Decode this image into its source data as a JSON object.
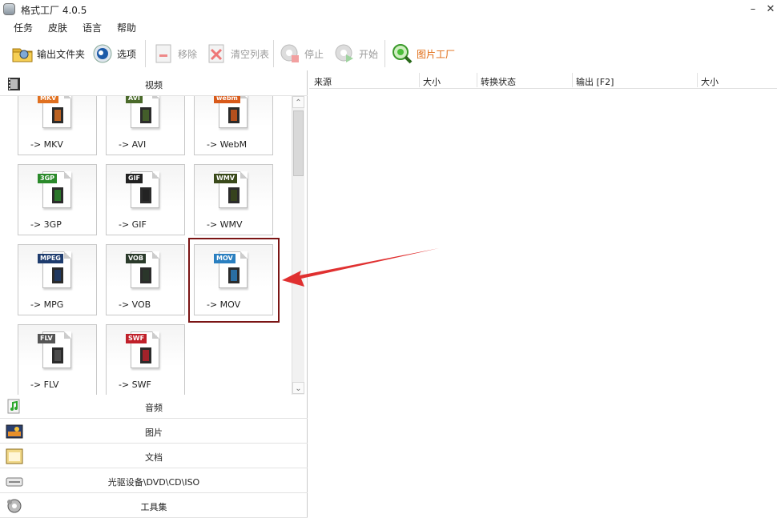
{
  "app": {
    "title": "格式工厂 4.0.5"
  },
  "menu": [
    "任务",
    "皮肤",
    "语言",
    "帮助"
  ],
  "toolbar": {
    "output_folder": "输出文件夹",
    "options": "选项",
    "remove": "移除",
    "clear_list": "清空列表",
    "stop": "停止",
    "start": "开始",
    "picture_factory": "图片工厂"
  },
  "categories": {
    "video": "视频",
    "audio": "音频",
    "image": "图片",
    "document": "文档",
    "optical": "光驱设备\\DVD\\CD\\ISO",
    "tools": "工具集"
  },
  "tiles": [
    {
      "badge": "MKV",
      "label": "-> MKV",
      "color": "#e07020"
    },
    {
      "badge": "AVI",
      "label": "-> AVI",
      "color": "#4a6a2a"
    },
    {
      "badge": "webm",
      "label": "-> WebM",
      "color": "#d85a1a"
    },
    {
      "badge": "3GP",
      "label": "-> 3GP",
      "color": "#2b8a2b"
    },
    {
      "badge": "GIF",
      "label": "-> GIF",
      "color": "#222222"
    },
    {
      "badge": "WMV",
      "label": "-> WMV",
      "color": "#3a4a1a"
    },
    {
      "badge": "MPEG",
      "label": "-> MPG",
      "color": "#1e3c6e"
    },
    {
      "badge": "VOB",
      "label": "-> VOB",
      "color": "#2a3a2a"
    },
    {
      "badge": "MOV",
      "label": "-> MOV",
      "color": "#2a7fc0"
    },
    {
      "badge": "FLV",
      "label": "-> FLV",
      "color": "#555555"
    },
    {
      "badge": "SWF",
      "label": "-> SWF",
      "color": "#c0202a"
    }
  ],
  "columns": [
    "来源",
    "大小",
    "转换状态",
    "输出 [F2]",
    "大小"
  ],
  "colors": {
    "highlight_border": "#7b1515",
    "arrow": "#e03030",
    "accent_link": "#e06a10"
  }
}
